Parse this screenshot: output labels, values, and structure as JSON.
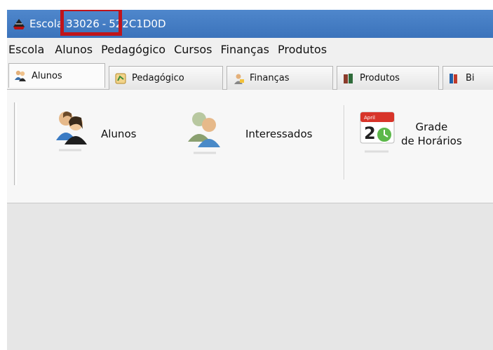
{
  "window": {
    "title_prefix": "Escola",
    "title_id": "33026",
    "title_separator": "-",
    "title_code": "522C1D0D"
  },
  "menu": [
    "Escola",
    "Alunos",
    "Pedagógico",
    "Cursos",
    "Finanças",
    "Produtos"
  ],
  "tabs": [
    {
      "label": "Alunos",
      "icon": "students-icon",
      "active": true
    },
    {
      "label": "Pedagógico",
      "icon": "pedagogic-icon",
      "active": false
    },
    {
      "label": "Finanças",
      "icon": "finance-icon",
      "active": false
    },
    {
      "label": "Produtos",
      "icon": "products-icon",
      "active": false
    },
    {
      "label": "Bi",
      "icon": "library-icon",
      "active": false
    }
  ],
  "ribbon": {
    "alunos_label": "Alunos",
    "interessados_label": "Interessados",
    "grade_line1": "Grade",
    "grade_line2": "de Horários",
    "calendar_month": "April",
    "calendar_day": "2"
  },
  "colors": {
    "titlebar": "#3f77c0",
    "highlight": "#c0141a"
  }
}
